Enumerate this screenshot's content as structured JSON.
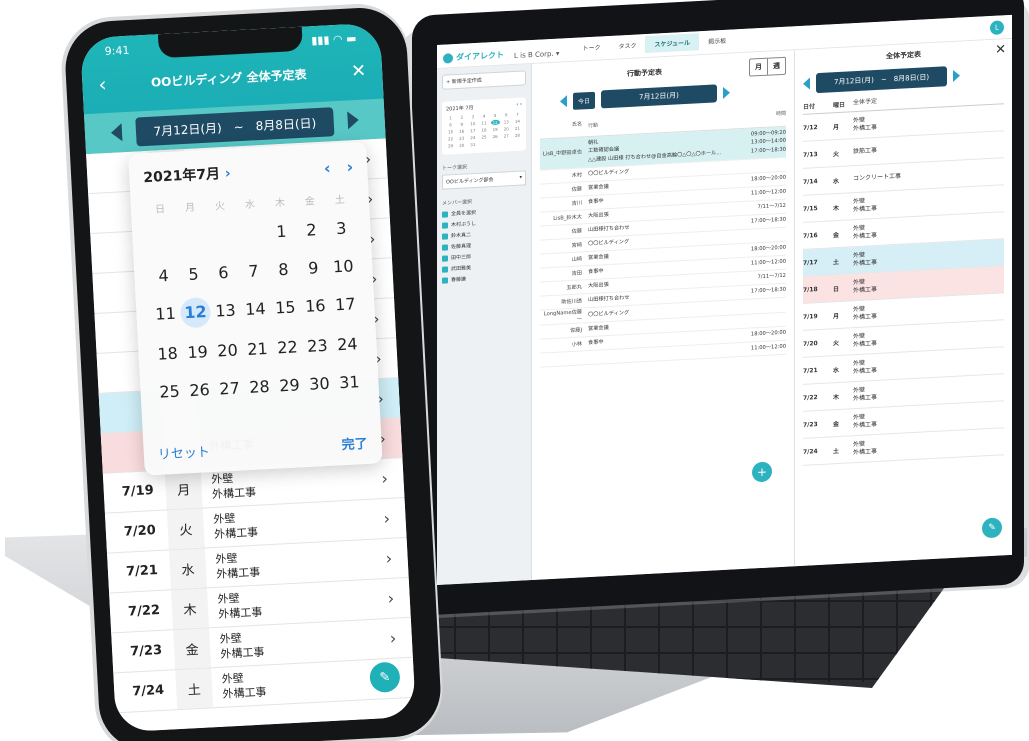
{
  "laptop": {
    "app_logo": "ダイアレクト",
    "corp": "L is B Corp. ▾",
    "tabs": [
      "トーク",
      "タスク",
      "スケジュール",
      "掲示板"
    ],
    "active_tab": "スケジュール",
    "avatar": "L",
    "sidebar": {
      "new_button": "+ 新規予定作成",
      "mini_month": "2021年 7月",
      "mini_days": [
        "1",
        "2",
        "3",
        "4",
        "5",
        "6",
        "7",
        "8",
        "9",
        "10",
        "11",
        "12",
        "13",
        "14",
        "15",
        "16",
        "17",
        "18",
        "19",
        "20",
        "21",
        "22",
        "23",
        "24",
        "25",
        "26",
        "27",
        "28",
        "29",
        "30",
        "31",
        "",
        "",
        "",
        "",
        ""
      ],
      "mini_selected": "12",
      "talk_label": "トーク選択",
      "talk_value": "OOビルディング部会",
      "member_label": "メンバー選択",
      "members": [
        "全員を選択",
        "木村ぷうし",
        "鈴木真二",
        "佐藤真理",
        "田中三郎",
        "武田雅美",
        "春藤謙"
      ]
    },
    "main": {
      "title": "行動予定表",
      "view_month": "月",
      "view_week": "週",
      "today": "今日",
      "date": "7月12日(月)",
      "col_name": "氏名",
      "col_action": "行動",
      "col_time": "時間",
      "rows": [
        {
          "name": "LisB_中野田卓也",
          "action": "朝礼\n工数確認会議\n△△建設 山田様 打ち合わせ@自金高輪〇△〇△〇ホール…",
          "time": "09:00〜09:20\n13:00〜14:00\n17:00〜18:30",
          "hl": true
        },
        {
          "name": "木村",
          "action": "〇〇ビルディング",
          "time": "",
          "hl": false
        },
        {
          "name": "佐藤",
          "action": "営業会議",
          "time": "18:00〜20:00",
          "hl": false
        },
        {
          "name": "吉川",
          "action": "食事中",
          "time": "11:00〜12:00",
          "hl": false
        },
        {
          "name": "LisB_鈴木大",
          "action": "大阪出張",
          "time": "7/11〜7/12",
          "hl": false
        },
        {
          "name": "佐藤",
          "action": "山田様打ち合わせ",
          "time": "17:00〜18:30",
          "hl": false
        },
        {
          "name": "宮崎",
          "action": "〇〇ビルディング",
          "time": "",
          "hl": false
        },
        {
          "name": "山崎",
          "action": "営業会議",
          "time": "18:00〜20:00",
          "hl": false
        },
        {
          "name": "吉田",
          "action": "食事中",
          "time": "11:00〜12:00",
          "hl": false
        },
        {
          "name": "五郎丸",
          "action": "大阪出張",
          "time": "7/11〜7/12",
          "hl": false
        },
        {
          "name": "助佐川透",
          "action": "山田様打ち合わせ",
          "time": "17:00〜18:30",
          "hl": false
        },
        {
          "name": "LongName佐藤一",
          "action": "〇〇ビルディング",
          "time": "",
          "hl": false
        },
        {
          "name": "佐藤J",
          "action": "営業会議",
          "time": "",
          "hl": false
        },
        {
          "name": "小林",
          "action": "食事中",
          "time": "18:00〜20:00",
          "hl": false
        },
        {
          "name": "",
          "action": "",
          "time": "11:00〜12:00",
          "hl": false
        }
      ],
      "fab": "+"
    },
    "right": {
      "title": "全体予定表",
      "close": "✕",
      "range": "7月12日(月)　~　8月8日(日)",
      "col_date": "日付",
      "col_dow": "曜日",
      "col_event": "全体予定",
      "rows": [
        {
          "date": "7/12",
          "dow": "月",
          "event": "外壁\n外構工事",
          "kind": ""
        },
        {
          "date": "7/13",
          "dow": "火",
          "event": "鉄筋工事",
          "kind": ""
        },
        {
          "date": "7/14",
          "dow": "水",
          "event": "コンクリート工事",
          "kind": ""
        },
        {
          "date": "7/15",
          "dow": "木",
          "event": "外壁\n外構工事",
          "kind": ""
        },
        {
          "date": "7/16",
          "dow": "金",
          "event": "外壁\n外構工事",
          "kind": ""
        },
        {
          "date": "7/17",
          "dow": "土",
          "event": "外壁\n外構工事",
          "kind": "sat"
        },
        {
          "date": "7/18",
          "dow": "日",
          "event": "外壁\n外構工事",
          "kind": "sun"
        },
        {
          "date": "7/19",
          "dow": "月",
          "event": "外壁\n外構工事",
          "kind": ""
        },
        {
          "date": "7/20",
          "dow": "火",
          "event": "外壁\n外構工事",
          "kind": ""
        },
        {
          "date": "7/21",
          "dow": "水",
          "event": "外壁\n外構工事",
          "kind": ""
        },
        {
          "date": "7/22",
          "dow": "木",
          "event": "外壁\n外構工事",
          "kind": ""
        },
        {
          "date": "7/23",
          "dow": "金",
          "event": "外壁\n外構工事",
          "kind": ""
        },
        {
          "date": "7/24",
          "dow": "土",
          "event": "外壁\n外構工事",
          "kind": ""
        }
      ]
    }
  },
  "phone": {
    "time": "9:41",
    "signal": "▮▮▮ ◠ ▬",
    "back": "‹",
    "title": "OOビルディング 全体予定表",
    "close": "✕",
    "range": "7月12日(月)　~　8月8日(日)",
    "calendar": {
      "month": "2021年7月",
      "prev": "‹",
      "next": "›",
      "dow": [
        "日",
        "月",
        "火",
        "水",
        "木",
        "金",
        "土"
      ],
      "days": [
        "",
        "",
        "",
        "",
        "1",
        "2",
        "3",
        "4",
        "5",
        "6",
        "7",
        "8",
        "9",
        "10",
        "11",
        "12",
        "13",
        "14",
        "15",
        "16",
        "17",
        "18",
        "19",
        "20",
        "21",
        "22",
        "23",
        "24",
        "25",
        "26",
        "27",
        "28",
        "29",
        "30",
        "31"
      ],
      "selected": "12",
      "reset": "リセット",
      "done": "完了"
    },
    "rows": [
      {
        "date": "",
        "dow": "",
        "event": "",
        "kind": ""
      },
      {
        "date": "",
        "dow": "",
        "event": "",
        "kind": ""
      },
      {
        "date": "",
        "dow": "",
        "event": "",
        "kind": ""
      },
      {
        "date": "",
        "dow": "",
        "event": "",
        "kind": ""
      },
      {
        "date": "",
        "dow": "",
        "event": "",
        "kind": ""
      },
      {
        "date": "",
        "dow": "",
        "event": "",
        "kind": ""
      },
      {
        "date": "",
        "dow": "",
        "event": "",
        "kind": "sat"
      },
      {
        "date": "",
        "dow": "",
        "event": "外構工事",
        "kind": "sun"
      },
      {
        "date": "7/19",
        "dow": "月",
        "event": "外壁\n外構工事",
        "kind": ""
      },
      {
        "date": "7/20",
        "dow": "火",
        "event": "外壁\n外構工事",
        "kind": ""
      },
      {
        "date": "7/21",
        "dow": "水",
        "event": "外壁\n外構工事",
        "kind": ""
      },
      {
        "date": "7/22",
        "dow": "木",
        "event": "外壁\n外構工事",
        "kind": ""
      },
      {
        "date": "7/23",
        "dow": "金",
        "event": "外壁\n外構工事",
        "kind": ""
      },
      {
        "date": "7/24",
        "dow": "土",
        "event": "外壁\n外構工事",
        "kind": ""
      }
    ],
    "fab_icon": "pencil-icon"
  },
  "colors": {
    "accent": "#1fb6b8",
    "navy": "#1f4a63",
    "blue": "#2a7fd4",
    "saturday": "#cfeef7",
    "sunday": "#f9dcdd"
  }
}
